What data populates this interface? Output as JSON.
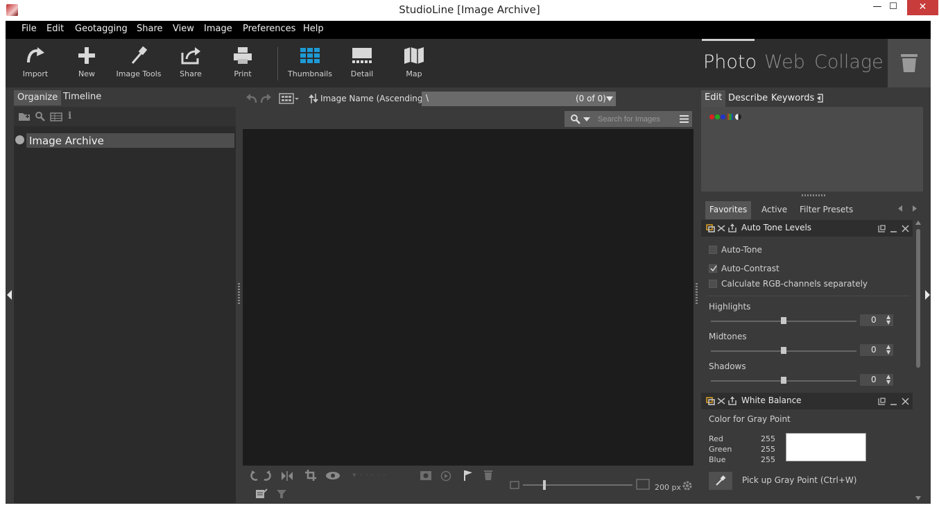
{
  "window": {
    "title": "StudioLine [Image Archive]",
    "minimize_glyph": "—",
    "maximize_glyph": "☐",
    "close_glyph": "✕"
  },
  "menu": [
    "File",
    "Edit",
    "Geotagging",
    "Share",
    "View",
    "Image",
    "Preferences",
    "Help"
  ],
  "toolbar": {
    "import": "Import",
    "new": "New",
    "image_tools": "Image Tools",
    "share": "Share",
    "print": "Print",
    "thumbnails": "Thumbnails",
    "detail": "Detail",
    "map": "Map",
    "accent_color": "#1e9ad6"
  },
  "modes": {
    "photo": "Photo",
    "web": "Web",
    "collage": "Collage"
  },
  "left_panel": {
    "tabs": {
      "organize": "Organize",
      "timeline": "Timeline"
    },
    "archive_label": "Image Archive"
  },
  "center": {
    "sort_label": "Image Name (Ascending)",
    "path": "\\",
    "count": "(0 of 0)",
    "search_placeholder": "Search for Images",
    "zoom_value": "200 px"
  },
  "right_panel": {
    "tabs": {
      "edit": "Edit",
      "describe": "Describe",
      "keywords": "Keywords"
    },
    "filter_tabs": {
      "favorites": "Favorites",
      "active": "Active",
      "filter_presets": "Filter Presets"
    },
    "auto_tone": {
      "title": "Auto Tone Levels",
      "auto_tone": "Auto-Tone",
      "auto_contrast": "Auto-Contrast",
      "calc_rgb": "Calculate RGB-channels separately",
      "highlights_label": "Highlights",
      "highlights_value": "0",
      "midtones_label": "Midtones",
      "midtones_value": "0",
      "shadows_label": "Shadows",
      "shadows_value": "0"
    },
    "white_balance": {
      "title": "White Balance",
      "gray_point_label": "Color for Gray Point",
      "red_label": "Red",
      "red_value": "255",
      "green_label": "Green",
      "green_value": "255",
      "blue_label": "Blue",
      "blue_value": "255",
      "pickup_label": "Pick up Gray Point (Ctrl+W)"
    }
  }
}
